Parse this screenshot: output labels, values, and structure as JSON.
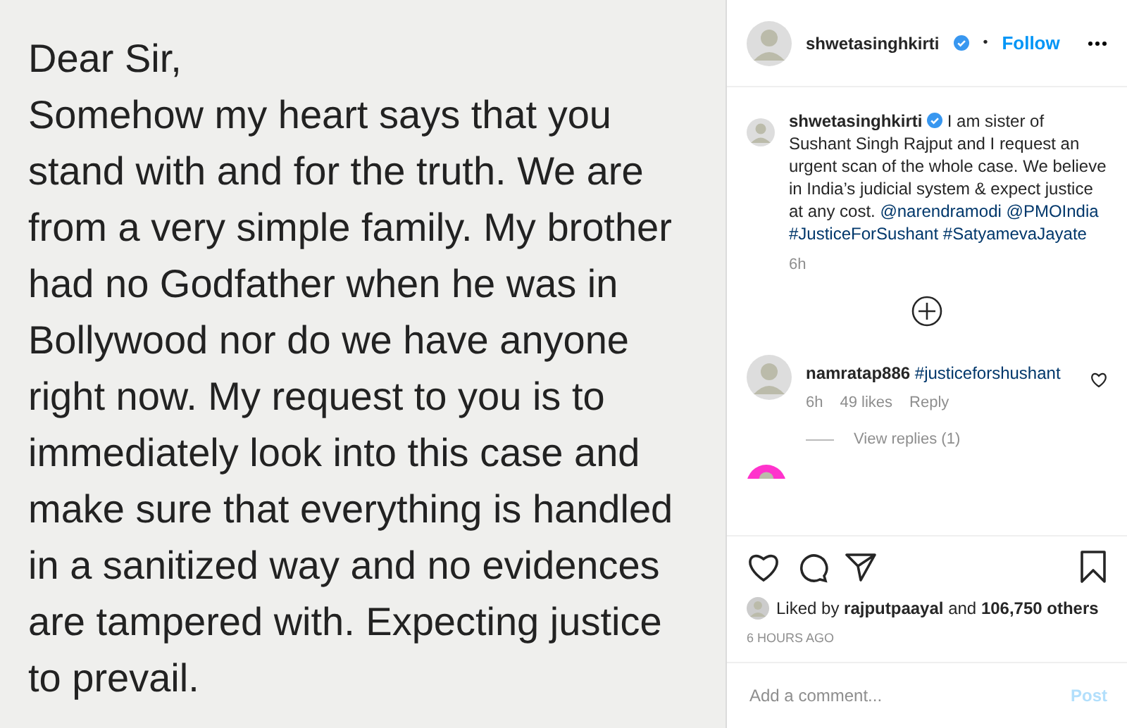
{
  "note": {
    "lines": [
      "Dear Sir,",
      "Somehow my heart says that you",
      "stand with and for the truth. We are",
      "from a very simple family. My brother",
      "had no Godfather when he was in",
      "Bollywood nor do we have anyone",
      "right now. My request to you is to",
      "immediately look into this case and",
      "make sure that everything is handled",
      "in a sanitized way and no evidences",
      "are tampered with.  Expecting justice",
      "to prevail."
    ]
  },
  "header": {
    "username": "shwetasinghkirti",
    "verified": true,
    "separator": "•",
    "follow": "Follow"
  },
  "caption": {
    "username": "shwetasinghkirti",
    "verified": true,
    "text": "I am sister of Sushant Singh Rajput and I request an urgent scan of the whole case. We believe in India’s judicial system & expect justice at any cost.",
    "tags": [
      "@narendramodi",
      "@PMOIndia",
      "#JusticeForSushant",
      "#SatyamevaJayate"
    ],
    "time": "6h"
  },
  "comments": [
    {
      "username": "namratap886",
      "text": "#justiceforshushant",
      "time": "6h",
      "likes": "49 likes",
      "reply": "Reply",
      "liked": false,
      "view_replies": "View replies (1)"
    }
  ],
  "actions": {
    "liked": false,
    "saved": false
  },
  "likes": {
    "prefix": "Liked by",
    "user": "rajputpaayal",
    "joiner": "and",
    "others": "106,750 others"
  },
  "timestamp": "6 HOURS AGO",
  "comment_box": {
    "placeholder": "Add a comment...",
    "post": "Post",
    "post_disabled": true
  }
}
